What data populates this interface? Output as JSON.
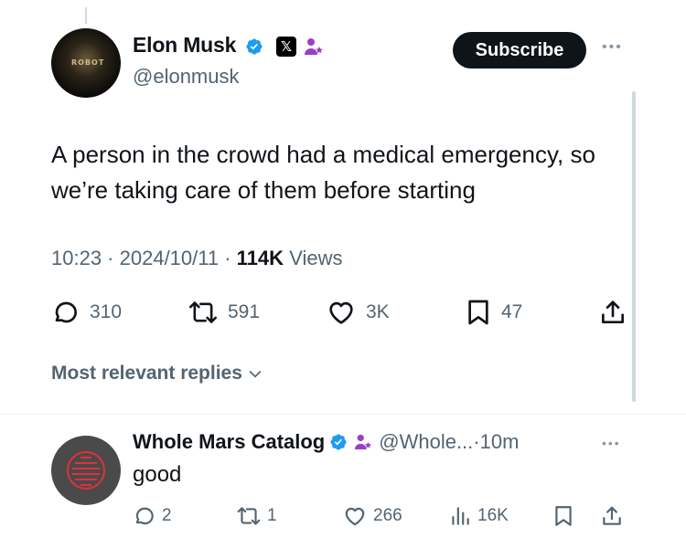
{
  "tweet": {
    "author_name": "Elon Musk",
    "author_handle": "@elonmusk",
    "subscribe_label": "Subscribe",
    "text": "A person in the crowd had a medical emergency, so we’re taking care of them before starting",
    "time": "10:23",
    "date": "2024/10/11",
    "views_count": "114K",
    "views_label": "Views",
    "separator": " · ",
    "actions": {
      "replies": "310",
      "reposts": "591",
      "likes": "3K",
      "bookmarks": "47"
    }
  },
  "replies_section": {
    "sort_label": "Most relevant replies"
  },
  "reply": {
    "author_name": "Whole Mars Catalog",
    "author_handle": "@Whole...",
    "time_sep": " · ",
    "time": "10m",
    "text": "good",
    "actions": {
      "replies": "2",
      "reposts": "1",
      "likes": "266",
      "views": "16K"
    }
  },
  "colors": {
    "verified": "#1d9bf0",
    "affiliate": "#9b3fc6",
    "reply_logo": "#e0313c",
    "muted": "#536471"
  },
  "icons": [
    "verified-badge-icon",
    "x-logo-icon",
    "affiliate-icon",
    "more-icon",
    "reply-icon",
    "repost-icon",
    "like-icon",
    "bookmark-icon",
    "share-icon",
    "views-icon",
    "chevron-down-icon"
  ]
}
